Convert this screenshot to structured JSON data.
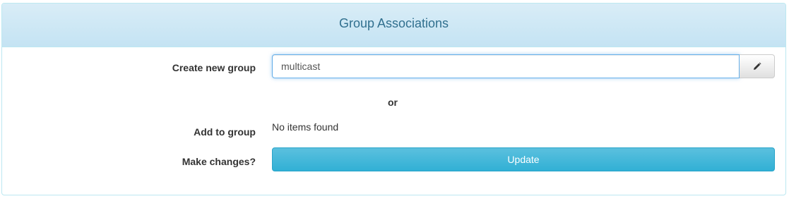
{
  "panel": {
    "title": "Group Associations"
  },
  "create_group": {
    "label": "Create new group",
    "input_value": "multicast",
    "edit_icon": "pencil-icon"
  },
  "separator": {
    "text": "or"
  },
  "add_to_group": {
    "label": "Add to group",
    "empty_text": "No items found"
  },
  "make_changes": {
    "label": "Make changes?",
    "button_label": "Update"
  },
  "colors": {
    "heading_bg": "#d9edf7",
    "heading_text": "#31708f",
    "info_button": "#5bc0de"
  }
}
